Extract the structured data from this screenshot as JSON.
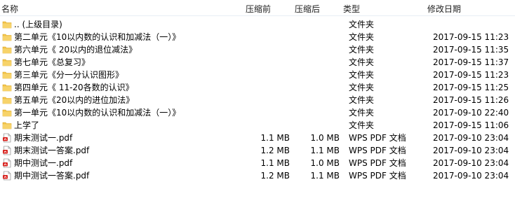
{
  "columns": {
    "name": "名称",
    "size_before": "压缩前",
    "size_after": "压缩后",
    "type": "类型",
    "modified": "修改日期"
  },
  "rows": [
    {
      "icon": "folder-icon",
      "name": ".. (上级目录)",
      "size_before": "",
      "size_after": "",
      "type": "文件夹",
      "modified": ""
    },
    {
      "icon": "folder-icon",
      "name": "第二单元《10以内数的认识和加减法（一）》",
      "size_before": "",
      "size_after": "",
      "type": "文件夹",
      "modified": "2017-09-15 11:23"
    },
    {
      "icon": "folder-icon",
      "name": "第六单元《 20以内的退位减法》",
      "size_before": "",
      "size_after": "",
      "type": "文件夹",
      "modified": "2017-09-15 11:35"
    },
    {
      "icon": "folder-icon",
      "name": "第七单元《总复习》",
      "size_before": "",
      "size_after": "",
      "type": "文件夹",
      "modified": "2017-09-15 11:37"
    },
    {
      "icon": "folder-icon",
      "name": "第三单元《分一分认识图形》",
      "size_before": "",
      "size_after": "",
      "type": "文件夹",
      "modified": "2017-09-15 11:23"
    },
    {
      "icon": "folder-icon",
      "name": "第四单元《 11-20各数的认识》",
      "size_before": "",
      "size_after": "",
      "type": "文件夹",
      "modified": "2017-09-15 11:25"
    },
    {
      "icon": "folder-icon",
      "name": "第五单元《20以内的进位加法》",
      "size_before": "",
      "size_after": "",
      "type": "文件夹",
      "modified": "2017-09-15 11:26"
    },
    {
      "icon": "folder-icon",
      "name": "第一单元《10以内数的认识和加减法（一）》",
      "size_before": "",
      "size_after": "",
      "type": "文件夹",
      "modified": "2017-09-10 22:40"
    },
    {
      "icon": "folder-icon",
      "name": "上学了",
      "size_before": "",
      "size_after": "",
      "type": "文件夹",
      "modified": "2017-09-15 11:06"
    },
    {
      "icon": "pdf-icon",
      "name": "期末测试一.pdf",
      "size_before": "1.1 MB",
      "size_after": "1.0 MB",
      "type": "WPS PDF 文档",
      "modified": "2017-09-10 23:04"
    },
    {
      "icon": "pdf-icon",
      "name": "期末测试一答案.pdf",
      "size_before": "1.2 MB",
      "size_after": "1.1 MB",
      "type": "WPS PDF 文档",
      "modified": "2017-09-10 23:04"
    },
    {
      "icon": "pdf-icon",
      "name": "期中测试一.pdf",
      "size_before": "1.1 MB",
      "size_after": "1.0 MB",
      "type": "WPS PDF 文档",
      "modified": "2017-09-10 23:04"
    },
    {
      "icon": "pdf-icon",
      "name": "期中测试一答案.pdf",
      "size_before": "1.2 MB",
      "size_after": "1.1 MB",
      "type": "WPS PDF 文档",
      "modified": "2017-09-10 23:04"
    }
  ],
  "colors": {
    "folder": "#f3c44b",
    "folder_dark": "#d9a520",
    "pdf": "#d8231f",
    "header_border": "#e8eef5"
  }
}
